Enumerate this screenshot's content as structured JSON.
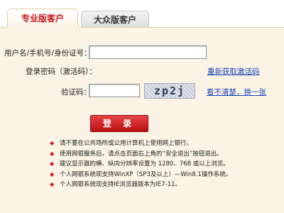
{
  "tabs": [
    {
      "label": "专业版客户",
      "active": true
    },
    {
      "label": "大众版客户",
      "active": false
    }
  ],
  "form": {
    "username_label": "用户名/手机号/身份证号：",
    "username_value": "",
    "activation_label": "登录密码（激活码）：",
    "activation_link": "重新获取激活码",
    "captcha_label": "验证码：",
    "captcha_value": "",
    "captcha_text": "zp2j",
    "captcha_refresh": "看不清楚，换一张"
  },
  "login_button": "登 录",
  "tips": [
    "请不要在公共场所或公用计算机上使用网上银行。",
    "使用网银服务后，请点击页面右上角的“安全退出”按钮退出。",
    "建议显示器的横、纵向分辨率设置为 1280、768 或以上浏览。",
    "个人网银系统现支持WinXP（SP3及以上）—Win8.1操作系统。",
    "个人网银系统现支持IE浏览器版本为IE7-11。"
  ],
  "colors": {
    "accent": "#c8161d",
    "panel_bg": "#fbf4e6",
    "link": "#1a44b8"
  },
  "icons": [
    "bullet-diamond-icon"
  ]
}
